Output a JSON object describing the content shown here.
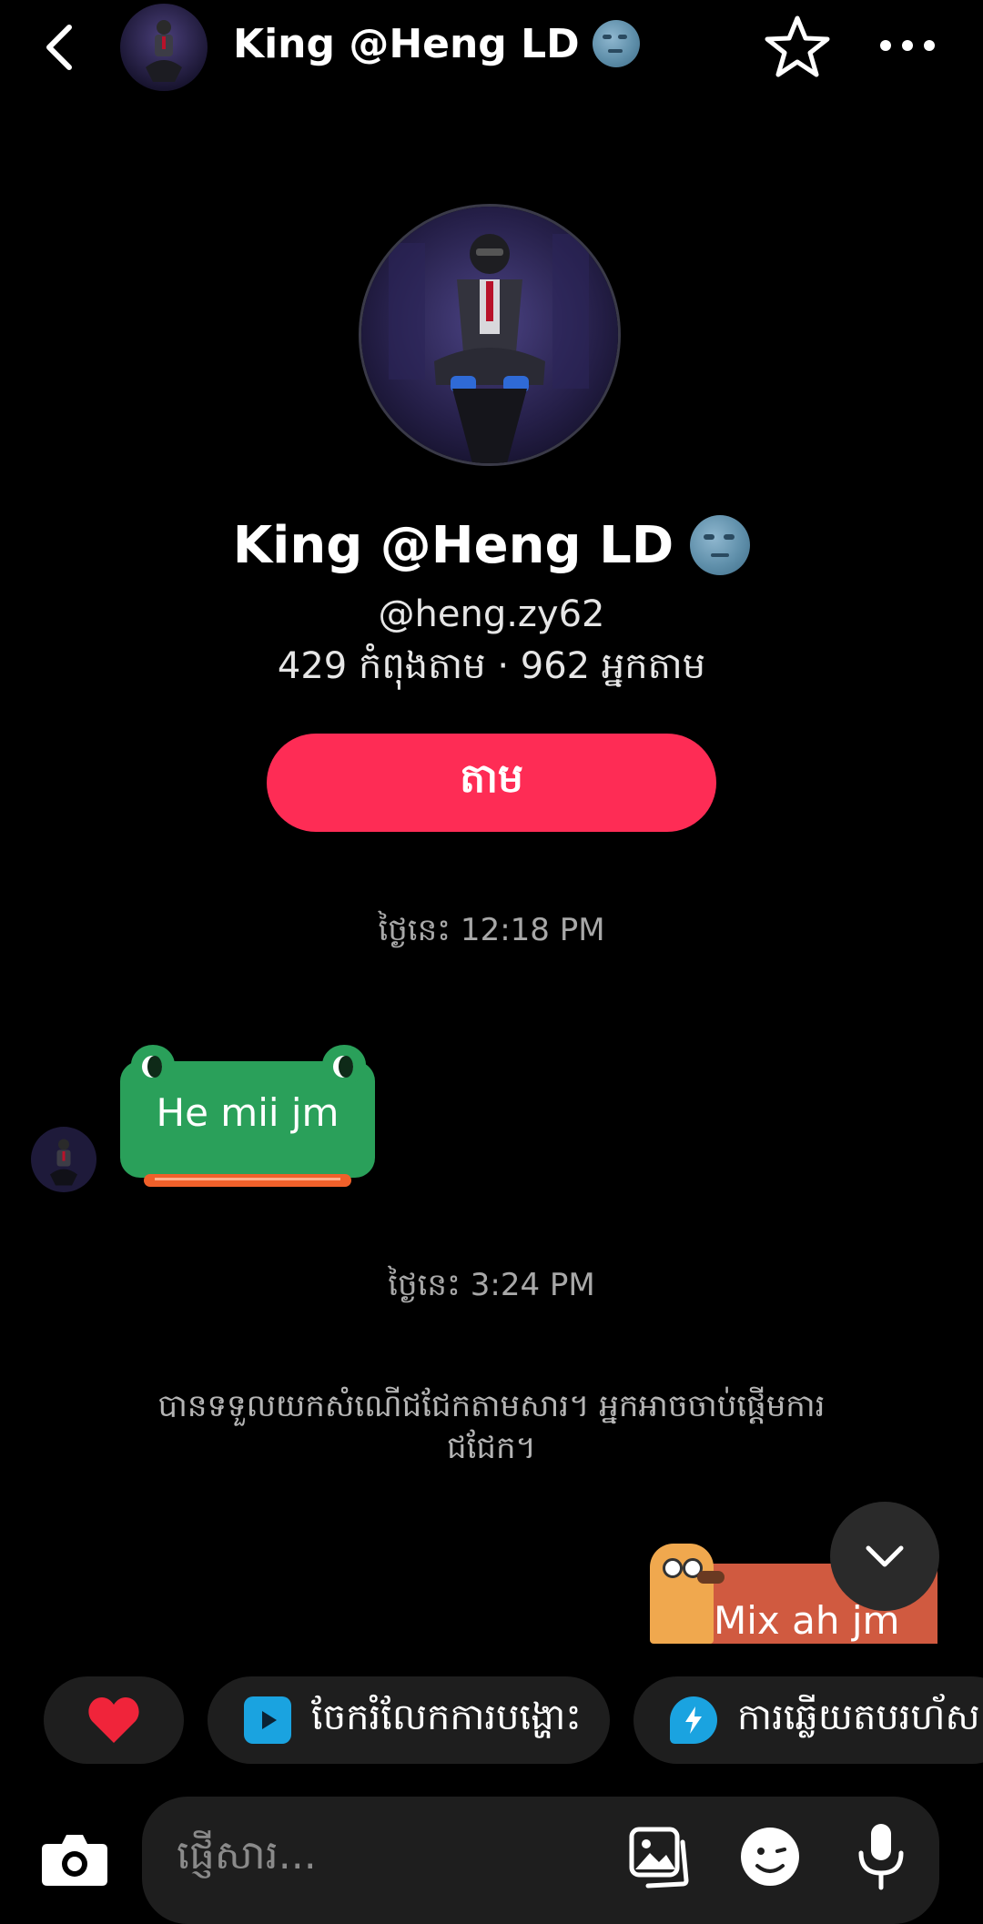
{
  "header": {
    "title": "King @Heng LD",
    "back_icon": "chevron-left-icon",
    "star_icon": "star-outline-icon",
    "more_icon": "more-horizontal-icon"
  },
  "profile": {
    "display_name": "King @Heng LD",
    "handle": "@heng.zy62",
    "stats": "429 កំពុងតាម · 962 អ្នកតាម",
    "follow_label": "តាម",
    "accent_color": "#fe2c55"
  },
  "chat": {
    "timestamp_1": "ថ្ងៃនេះ 12:18 PM",
    "received_message": "He mii jm",
    "timestamp_2": "ថ្ងៃនេះ 3:24 PM",
    "system_note": "បានទទួលយកសំណើជជែកតាមសារ។ អ្នកអាចចាប់ផ្តើមការជជែក។",
    "sent_message": "Mix ah jm"
  },
  "quick_actions": {
    "heart": "❤️",
    "share_label": "ចែករំលែកការបង្ហោះ",
    "quick_reply_label": "ការឆ្លើយតបរហ័ស"
  },
  "composer": {
    "placeholder": "ផ្ញើសារ..."
  }
}
